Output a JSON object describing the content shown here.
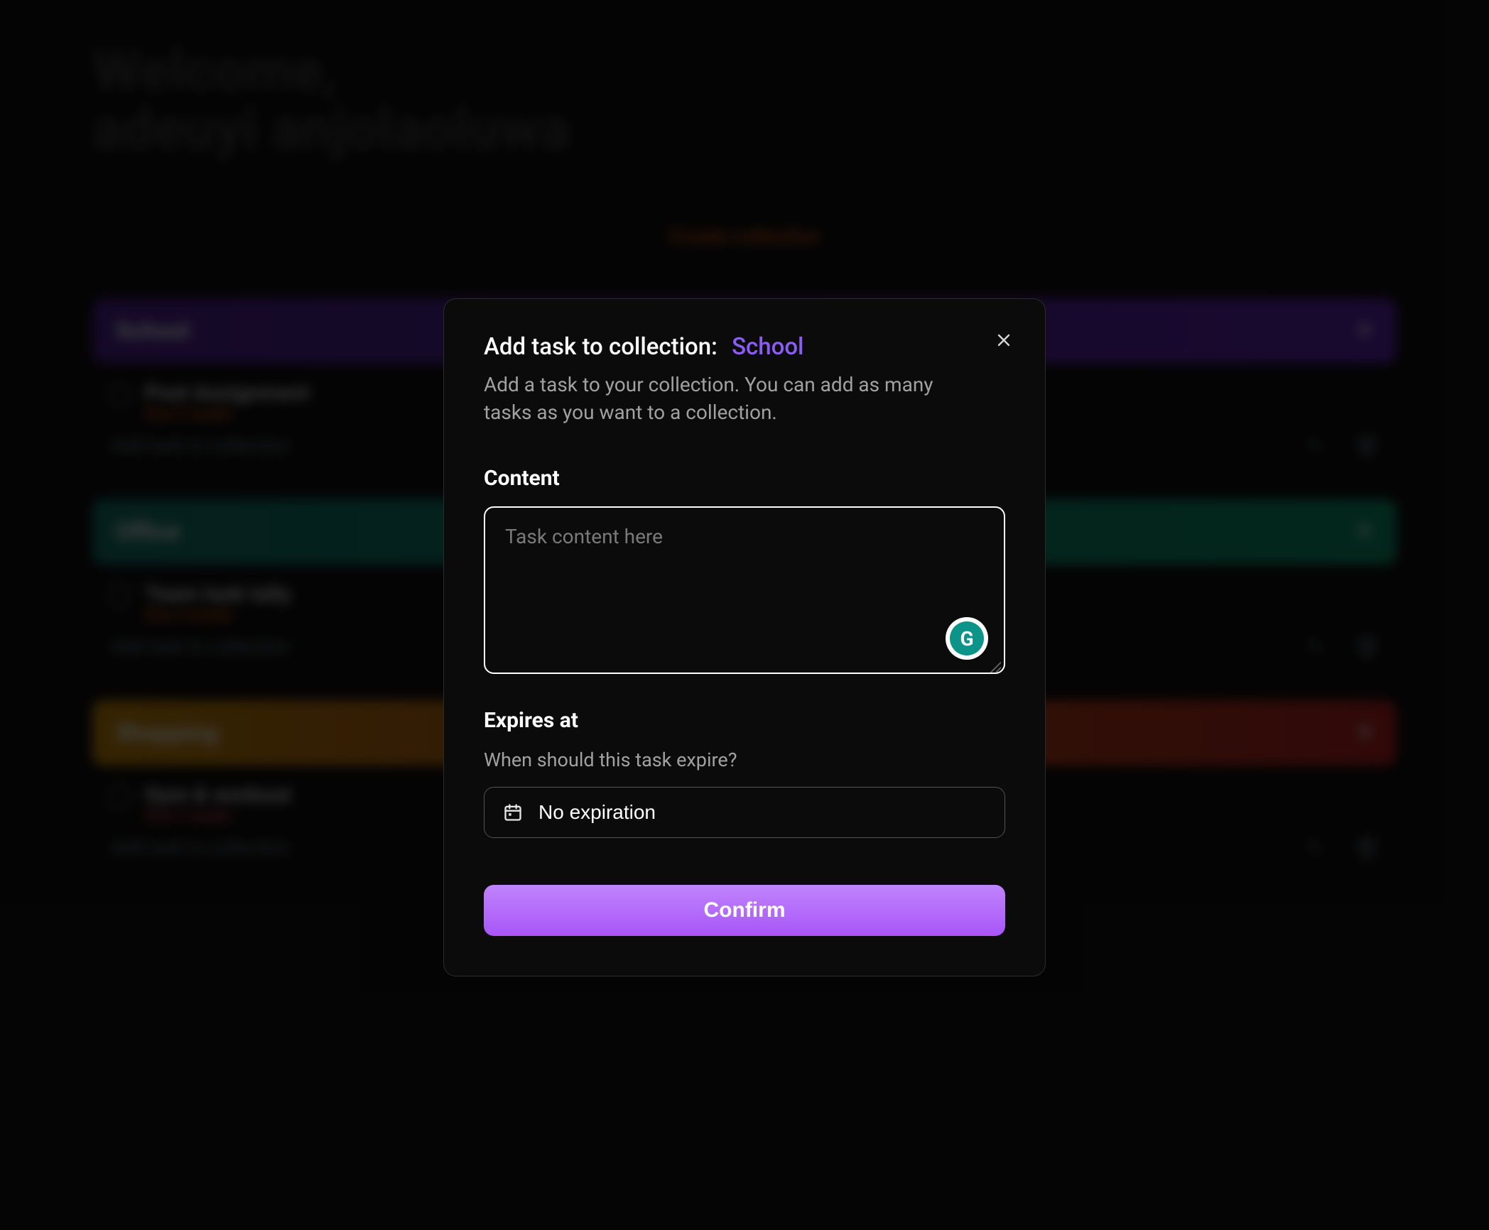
{
  "welcome": {
    "line1": "Welcome,",
    "line2": "adeuyi anjolaoluwa"
  },
  "create_button": "Create collection",
  "collections": [
    {
      "name": "School",
      "header_class": "coll-school",
      "task_title": "Post Assignment",
      "task_meta": "Due 2 weeks",
      "meta_class": "meta-orange",
      "add_text": "Add task to collection"
    },
    {
      "name": "Office",
      "header_class": "coll-office",
      "task_title": "Team task tally",
      "task_meta": "Due 4 weeks",
      "meta_class": "meta-orange",
      "add_text": "Add task to collection"
    },
    {
      "name": "Shopping",
      "header_class": "coll-shop",
      "task_title": "Gym & workout",
      "task_meta": "Due 2 weeks",
      "meta_class": "meta-red",
      "add_text": "Add task to collection"
    }
  ],
  "modal": {
    "title_prefix": "Add task to collection:",
    "collection": "School",
    "description": "Add a task to your collection. You can add as many tasks as you want to a collection.",
    "content_label": "Content",
    "content_placeholder": "Task content here",
    "grammarly_glyph": "G",
    "expires_label": "Expires at",
    "expires_sublabel": "When should this task expire?",
    "expires_value": "No expiration",
    "confirm": "Confirm"
  }
}
